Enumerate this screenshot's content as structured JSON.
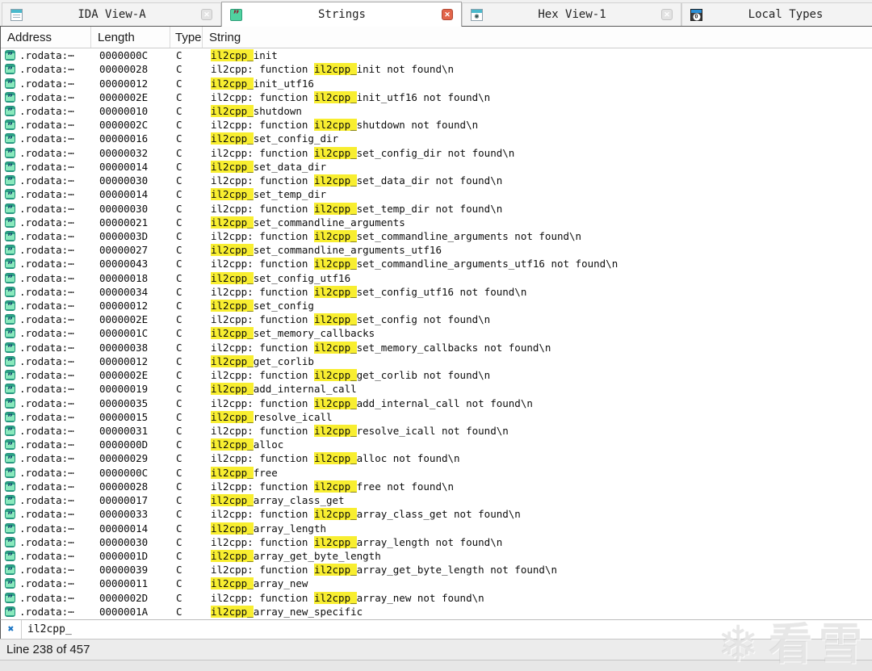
{
  "tabs": [
    {
      "label": "IDA View-A",
      "icon": "ida-view-icon",
      "active": false,
      "closable": true,
      "close_red": false
    },
    {
      "label": "Strings",
      "icon": "strings-icon",
      "active": true,
      "closable": true,
      "close_red": true
    },
    {
      "label": "Hex View-1",
      "icon": "hex-view-icon",
      "active": false,
      "closable": true,
      "close_red": false
    },
    {
      "label": "Local Types",
      "icon": "local-types-icon",
      "active": false,
      "closable": false,
      "close_red": false
    }
  ],
  "table": {
    "columns": [
      "Address",
      "Length",
      "Type",
      "String"
    ],
    "row_icon": "string-literal-icon",
    "highlight": "il2cpp_",
    "rows": [
      [
        ".rodata:⋯",
        "0000000C",
        "C",
        "il2cpp_init"
      ],
      [
        ".rodata:⋯",
        "00000028",
        "C",
        "il2cpp: function il2cpp_init not found\\n"
      ],
      [
        ".rodata:⋯",
        "00000012",
        "C",
        "il2cpp_init_utf16"
      ],
      [
        ".rodata:⋯",
        "0000002E",
        "C",
        "il2cpp: function il2cpp_init_utf16 not found\\n"
      ],
      [
        ".rodata:⋯",
        "00000010",
        "C",
        "il2cpp_shutdown"
      ],
      [
        ".rodata:⋯",
        "0000002C",
        "C",
        "il2cpp: function il2cpp_shutdown not found\\n"
      ],
      [
        ".rodata:⋯",
        "00000016",
        "C",
        "il2cpp_set_config_dir"
      ],
      [
        ".rodata:⋯",
        "00000032",
        "C",
        "il2cpp: function il2cpp_set_config_dir not found\\n"
      ],
      [
        ".rodata:⋯",
        "00000014",
        "C",
        "il2cpp_set_data_dir"
      ],
      [
        ".rodata:⋯",
        "00000030",
        "C",
        "il2cpp: function il2cpp_set_data_dir not found\\n"
      ],
      [
        ".rodata:⋯",
        "00000014",
        "C",
        "il2cpp_set_temp_dir"
      ],
      [
        ".rodata:⋯",
        "00000030",
        "C",
        "il2cpp: function il2cpp_set_temp_dir not found\\n"
      ],
      [
        ".rodata:⋯",
        "00000021",
        "C",
        "il2cpp_set_commandline_arguments"
      ],
      [
        ".rodata:⋯",
        "0000003D",
        "C",
        "il2cpp: function il2cpp_set_commandline_arguments not found\\n"
      ],
      [
        ".rodata:⋯",
        "00000027",
        "C",
        "il2cpp_set_commandline_arguments_utf16"
      ],
      [
        ".rodata:⋯",
        "00000043",
        "C",
        "il2cpp: function il2cpp_set_commandline_arguments_utf16 not found\\n"
      ],
      [
        ".rodata:⋯",
        "00000018",
        "C",
        "il2cpp_set_config_utf16"
      ],
      [
        ".rodata:⋯",
        "00000034",
        "C",
        "il2cpp: function il2cpp_set_config_utf16 not found\\n"
      ],
      [
        ".rodata:⋯",
        "00000012",
        "C",
        "il2cpp_set_config"
      ],
      [
        ".rodata:⋯",
        "0000002E",
        "C",
        "il2cpp: function il2cpp_set_config not found\\n"
      ],
      [
        ".rodata:⋯",
        "0000001C",
        "C",
        "il2cpp_set_memory_callbacks"
      ],
      [
        ".rodata:⋯",
        "00000038",
        "C",
        "il2cpp: function il2cpp_set_memory_callbacks not found\\n"
      ],
      [
        ".rodata:⋯",
        "00000012",
        "C",
        "il2cpp_get_corlib"
      ],
      [
        ".rodata:⋯",
        "0000002E",
        "C",
        "il2cpp: function il2cpp_get_corlib not found\\n"
      ],
      [
        ".rodata:⋯",
        "00000019",
        "C",
        "il2cpp_add_internal_call"
      ],
      [
        ".rodata:⋯",
        "00000035",
        "C",
        "il2cpp: function il2cpp_add_internal_call not found\\n"
      ],
      [
        ".rodata:⋯",
        "00000015",
        "C",
        "il2cpp_resolve_icall"
      ],
      [
        ".rodata:⋯",
        "00000031",
        "C",
        "il2cpp: function il2cpp_resolve_icall not found\\n"
      ],
      [
        ".rodata:⋯",
        "0000000D",
        "C",
        "il2cpp_alloc"
      ],
      [
        ".rodata:⋯",
        "00000029",
        "C",
        "il2cpp: function il2cpp_alloc not found\\n"
      ],
      [
        ".rodata:⋯",
        "0000000C",
        "C",
        "il2cpp_free"
      ],
      [
        ".rodata:⋯",
        "00000028",
        "C",
        "il2cpp: function il2cpp_free not found\\n"
      ],
      [
        ".rodata:⋯",
        "00000017",
        "C",
        "il2cpp_array_class_get"
      ],
      [
        ".rodata:⋯",
        "00000033",
        "C",
        "il2cpp: function il2cpp_array_class_get not found\\n"
      ],
      [
        ".rodata:⋯",
        "00000014",
        "C",
        "il2cpp_array_length"
      ],
      [
        ".rodata:⋯",
        "00000030",
        "C",
        "il2cpp: function il2cpp_array_length not found\\n"
      ],
      [
        ".rodata:⋯",
        "0000001D",
        "C",
        "il2cpp_array_get_byte_length"
      ],
      [
        ".rodata:⋯",
        "00000039",
        "C",
        "il2cpp: function il2cpp_array_get_byte_length not found\\n"
      ],
      [
        ".rodata:⋯",
        "00000011",
        "C",
        "il2cpp_array_new"
      ],
      [
        ".rodata:⋯",
        "0000002D",
        "C",
        "il2cpp: function il2cpp_array_new not found\\n"
      ],
      [
        ".rodata:⋯",
        "0000001A",
        "C",
        "il2cpp_array_new_specific"
      ]
    ]
  },
  "filter": {
    "close_glyph": "✖",
    "value": "il2cpp_"
  },
  "status_bar": {
    "text": "Line 238 of 457"
  },
  "watermark": {
    "snowflake_glyph": "❄",
    "text": "看雪"
  },
  "colors": {
    "highlight": "#f8ee30",
    "active_tab_close": "#e2654a",
    "filter_icon_blue": "#1d76c4",
    "string_icon_green": "#50d2a0"
  }
}
